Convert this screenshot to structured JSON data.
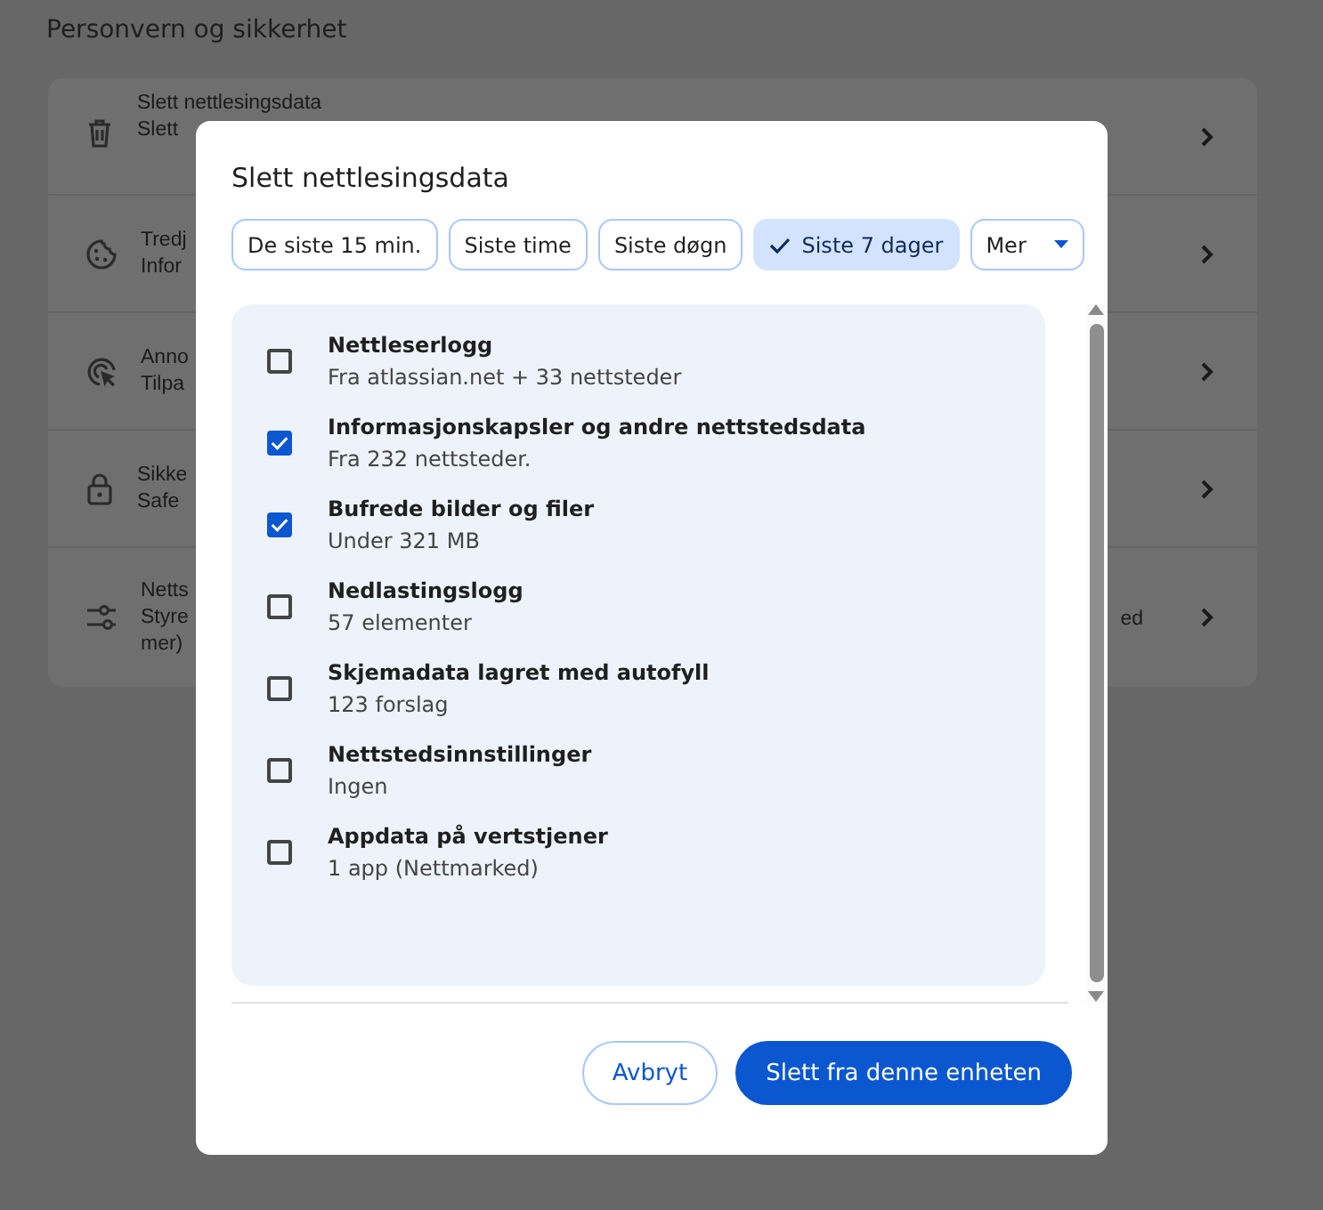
{
  "page": {
    "section_title": "Personvern og sikkerhet"
  },
  "settings_rows": [
    {
      "title": "Slett nettlesingsdata",
      "subtitle": "Slett"
    },
    {
      "title": "Tredj",
      "subtitle": "Infor"
    },
    {
      "title": "Anno",
      "subtitle": "Tilpa"
    },
    {
      "title": "Sikke",
      "subtitle": "Safe"
    },
    {
      "title": "Netts",
      "subtitle": "Styre",
      "subtitle_tail": "ed",
      "subtitle_line2": "mer)"
    }
  ],
  "dialog": {
    "title": "Slett nettlesingsdata",
    "time_ranges": [
      {
        "label": "De siste 15 min.",
        "selected": false,
        "kind": "chip"
      },
      {
        "label": "Siste time",
        "selected": false,
        "kind": "chip"
      },
      {
        "label": "Siste døgn",
        "selected": false,
        "kind": "chip"
      },
      {
        "label": "Siste 7 dager",
        "selected": true,
        "kind": "chip"
      },
      {
        "label": "Mer",
        "selected": false,
        "kind": "dropdown"
      }
    ],
    "items": [
      {
        "label": "Nettleserlogg",
        "detail": "Fra atlassian.net + 33 nettsteder",
        "checked": false
      },
      {
        "label": "Informasjonskapsler og andre nettstedsdata",
        "detail": "Fra 232 nettsteder.",
        "checked": true
      },
      {
        "label": "Bufrede bilder og filer",
        "detail": "Under 321 MB",
        "checked": true
      },
      {
        "label": "Nedlastingslogg",
        "detail": "57 elementer",
        "checked": false
      },
      {
        "label": "Skjemadata lagret med autofyll",
        "detail": "123 forslag",
        "checked": false
      },
      {
        "label": "Nettstedsinnstillinger",
        "detail": "Ingen",
        "checked": false
      },
      {
        "label": "Appdata på vertstjener",
        "detail": "1 app (Nettmarked)",
        "checked": false
      }
    ],
    "cancel_button": "Avbryt",
    "confirm_button": "Slett fra denne enheten"
  }
}
